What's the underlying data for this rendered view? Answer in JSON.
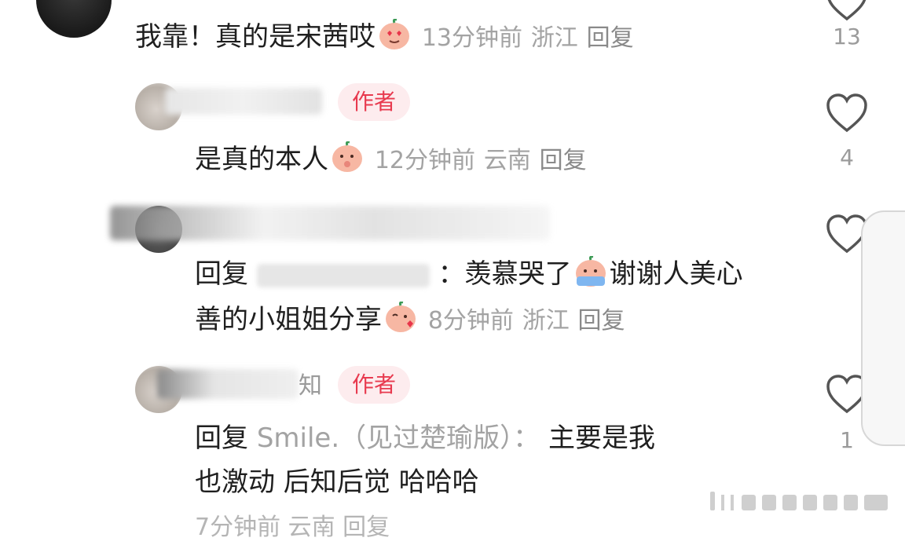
{
  "colors": {
    "author_tag_bg": "#fdecee",
    "author_tag_text": "#e83a4f",
    "meta_text": "#a3a3a3",
    "primary_text": "#1f1f1f"
  },
  "comments": [
    {
      "text": "我靠！真的是宋茜哎",
      "emoji": "heart-eyes-emoji",
      "time": "13分钟前",
      "location": "浙江",
      "reply_label": "回复",
      "like_count": "13"
    },
    {
      "author_badge": "作者",
      "text": "是真的本人",
      "emoji": "shy-emoji",
      "time": "12分钟前",
      "location": "云南",
      "reply_label": "回复",
      "like_count": "4"
    },
    {
      "reply_prefix": "回复",
      "text_line1": "：羡慕哭了",
      "text_line1b": "谢谢人美心",
      "text_line2": "善的小姐姐分享",
      "emoji1": "crying-emoji",
      "emoji2": "kiss-emoji",
      "time": "8分钟前",
      "location": "浙江",
      "reply_label": "回复",
      "like_count": ""
    },
    {
      "author_badge": "作者",
      "name_tail": "知",
      "reply_prefix": "回复",
      "mention": "Smile.（见过楚瑜版）：",
      "text_line1": "主要是我",
      "text_line2": "也激动 后知后觉 哈哈哈",
      "time_partial": "7分钟前  云南  回复",
      "like_count": "1"
    }
  ]
}
